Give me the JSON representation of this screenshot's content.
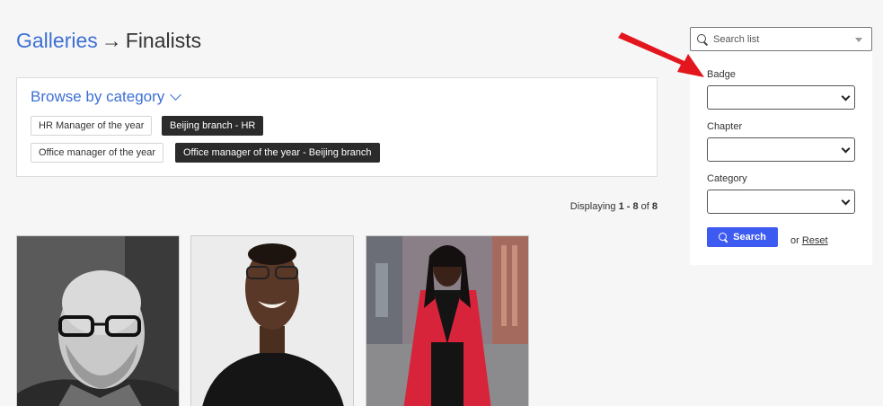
{
  "breadcrumb": {
    "parent": "Galleries",
    "separator": "→",
    "current": "Finalists"
  },
  "browse": {
    "heading": "Browse by category",
    "chips": [
      {
        "label": "HR Manager of the year",
        "selected": false
      },
      {
        "label": "Beijing branch - HR",
        "selected": true
      },
      {
        "label": "Office manager of the year",
        "selected": false
      },
      {
        "label": "Office manager of the year - Beijing branch",
        "selected": true
      }
    ]
  },
  "results": {
    "prefix": "Displaying ",
    "range": "1 - 8",
    "of": " of ",
    "total": "8"
  },
  "search": {
    "placeholder": "Search list",
    "filters": [
      {
        "label": "Badge",
        "value": ""
      },
      {
        "label": "Chapter",
        "value": ""
      },
      {
        "label": "Category",
        "value": ""
      }
    ],
    "search_button": "Search",
    "or_text": "or ",
    "reset_link": "Reset"
  },
  "colors": {
    "accent": "#3d6fd6",
    "button": "#3d5af1",
    "chip_selected": "#2b2b2b",
    "annotation_arrow": "#e3161e"
  },
  "gallery": {
    "items": [
      "photo-1",
      "photo-2",
      "photo-3"
    ]
  }
}
